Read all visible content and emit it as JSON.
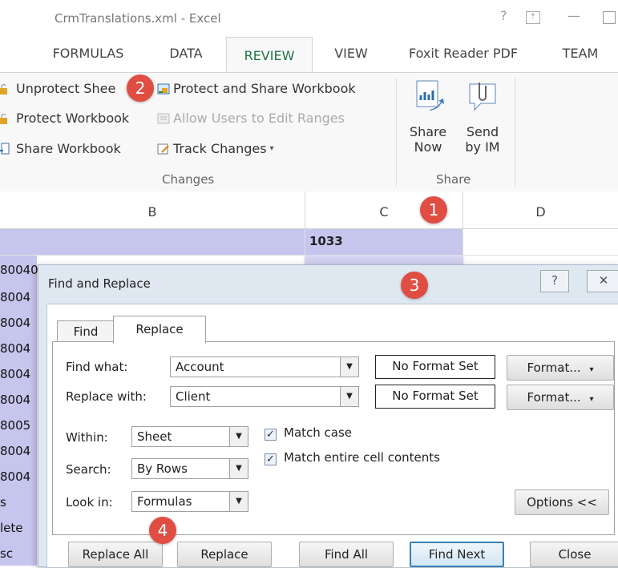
{
  "window": {
    "title": "CrmTranslations.xml - Excel"
  },
  "window_controls": {
    "help": "?",
    "restore": "⊼",
    "minimize": "—",
    "maximize": "☐"
  },
  "tabs": [
    "FORMULAS",
    "DATA",
    "REVIEW",
    "VIEW",
    "Foxit Reader PDF",
    "TEAM"
  ],
  "active_tab": "REVIEW",
  "ribbon": {
    "changes": {
      "unprotect_sheet": "Unprotect Shee",
      "protect_workbook": "Protect Workbook",
      "share_workbook": "Share Workbook",
      "protect_share": "Protect and Share Workbook",
      "allow_users": "Allow Users to Edit Ranges",
      "track_changes": "Track Changes",
      "label": "Changes"
    },
    "share": {
      "share_now_1": "Share",
      "share_now_2": "Now",
      "send_im_1": "Send",
      "send_im_2": "by IM",
      "label": "Share"
    }
  },
  "columns": [
    "B",
    "C",
    "D"
  ],
  "sheet": {
    "c1": "1033",
    "b_rows": [
      "80040...",
      "8004",
      "8004",
      "8004",
      "8004",
      "8004",
      "8005",
      "8004",
      "8004",
      "s",
      "lete",
      "sc"
    ]
  },
  "dialog": {
    "title": "Find and Replace",
    "help_btn": "?",
    "close_btn": "✕",
    "tab_find": "Find",
    "tab_replace": "Replace",
    "find_what_label": "Find what:",
    "find_what_value": "Account",
    "replace_with_label": "Replace with:",
    "replace_with_value": "Client",
    "no_format_1": "No Format Set",
    "no_format_2": "No Format Set",
    "format_btn_1": "Format...",
    "format_btn_2": "Format...",
    "within_label": "Within:",
    "within_value": "Sheet",
    "search_label": "Search:",
    "search_value": "By Rows",
    "lookin_label": "Look in:",
    "lookin_value": "Formulas",
    "match_case": "Match case",
    "match_case_checked": true,
    "match_entire": "Match entire cell contents",
    "match_entire_checked": true,
    "options_btn": "Options <<",
    "replace_all": "Replace All",
    "replace": "Replace",
    "find_all": "Find All",
    "find_next": "Find Next",
    "close": "Close"
  },
  "badges": [
    "1",
    "2",
    "3",
    "4"
  ],
  "colors": {
    "accent": "#217346",
    "badge": "#e04d43",
    "selected_cells": "#c6c5ee"
  }
}
